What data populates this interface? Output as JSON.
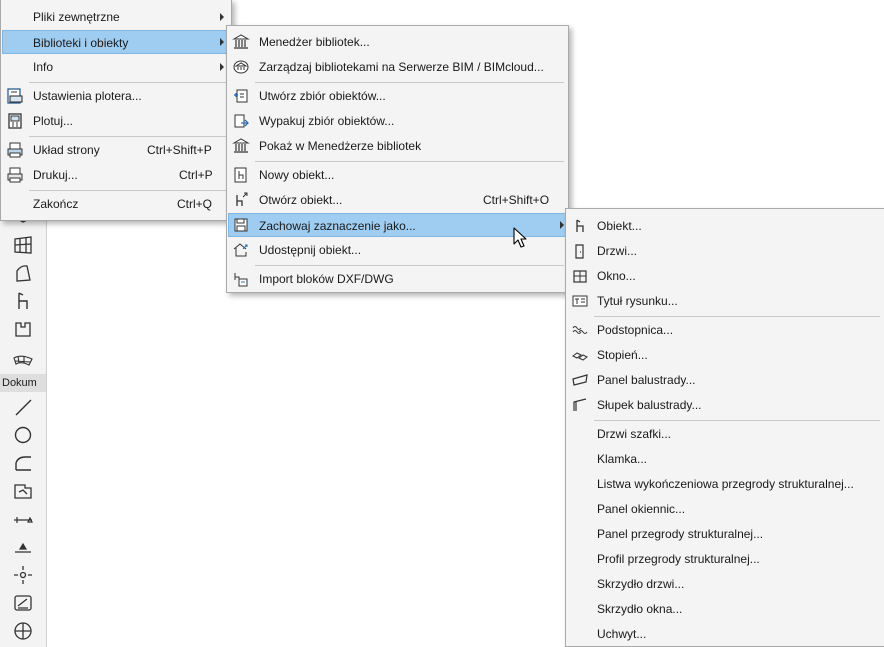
{
  "left_toolbox": {
    "section_label": "Dokum"
  },
  "main_menu": {
    "items": [
      {
        "label": "Pliki zewnętrzne",
        "has_submenu": true
      },
      {
        "label": "Biblioteki i obiekty",
        "has_submenu": true,
        "highlighted": true
      },
      {
        "label": "Info",
        "has_submenu": true
      },
      {
        "label": "Ustawienia plotera...",
        "icon": "plotter-settings-icon"
      },
      {
        "label": "Plotuj...",
        "icon": "plot-icon"
      },
      {
        "label": "Układ strony",
        "shortcut": "Ctrl+Shift+P",
        "icon": "page-setup-icon"
      },
      {
        "label": "Drukuj...",
        "shortcut": "Ctrl+P",
        "icon": "printer-icon"
      },
      {
        "label": "Zakończ",
        "shortcut": "Ctrl+Q"
      }
    ]
  },
  "libraries_menu": {
    "items": [
      {
        "label": "Menedżer bibliotek...",
        "icon": "library-manager-icon"
      },
      {
        "label": "Zarządzaj bibliotekami na Serwerze BIM / BIMcloud...",
        "icon": "bim-server-library-icon"
      },
      {
        "label": "Utwórz zbiór obiektów...",
        "icon": "create-container-icon"
      },
      {
        "label": "Wypakuj zbiór obiektów...",
        "icon": "extract-container-icon"
      },
      {
        "label": "Pokaż w Menedżerze bibliotek",
        "icon": "show-in-library-manager-icon"
      },
      {
        "label": "Nowy obiekt...",
        "icon": "new-object-icon"
      },
      {
        "label": "Otwórz obiekt...",
        "shortcut": "Ctrl+Shift+O",
        "icon": "open-object-icon"
      },
      {
        "label": "Zachowaj zaznaczenie jako...",
        "has_submenu": true,
        "highlighted": true,
        "icon": "save-selection-icon"
      },
      {
        "label": "Udostępnij obiekt...",
        "icon": "share-object-icon"
      },
      {
        "label": "Import bloków DXF/DWG",
        "icon": "import-dxf-icon"
      }
    ]
  },
  "save_as_menu": {
    "items": [
      {
        "label": "Obiekt...",
        "icon": "object-icon"
      },
      {
        "label": "Drzwi...",
        "icon": "door-icon"
      },
      {
        "label": "Okno...",
        "icon": "window-icon"
      },
      {
        "label": "Tytuł rysunku...",
        "icon": "drawing-title-icon"
      },
      {
        "label": "Podstopnica...",
        "icon": "riser-icon"
      },
      {
        "label": "Stopień...",
        "icon": "tread-icon"
      },
      {
        "label": "Panel balustrady...",
        "icon": "railing-panel-icon"
      },
      {
        "label": "Słupek balustrady...",
        "icon": "railing-post-icon"
      },
      {
        "label": "Drzwi szafki..."
      },
      {
        "label": "Klamka..."
      },
      {
        "label": "Listwa wykończeniowa przegrody strukturalnej..."
      },
      {
        "label": "Panel okiennic..."
      },
      {
        "label": "Panel przegrody strukturalnej..."
      },
      {
        "label": "Profil przegrody strukturalnej..."
      },
      {
        "label": "Skrzydło drzwi..."
      },
      {
        "label": "Skrzydło okna..."
      },
      {
        "label": "Uchwyt..."
      }
    ]
  }
}
